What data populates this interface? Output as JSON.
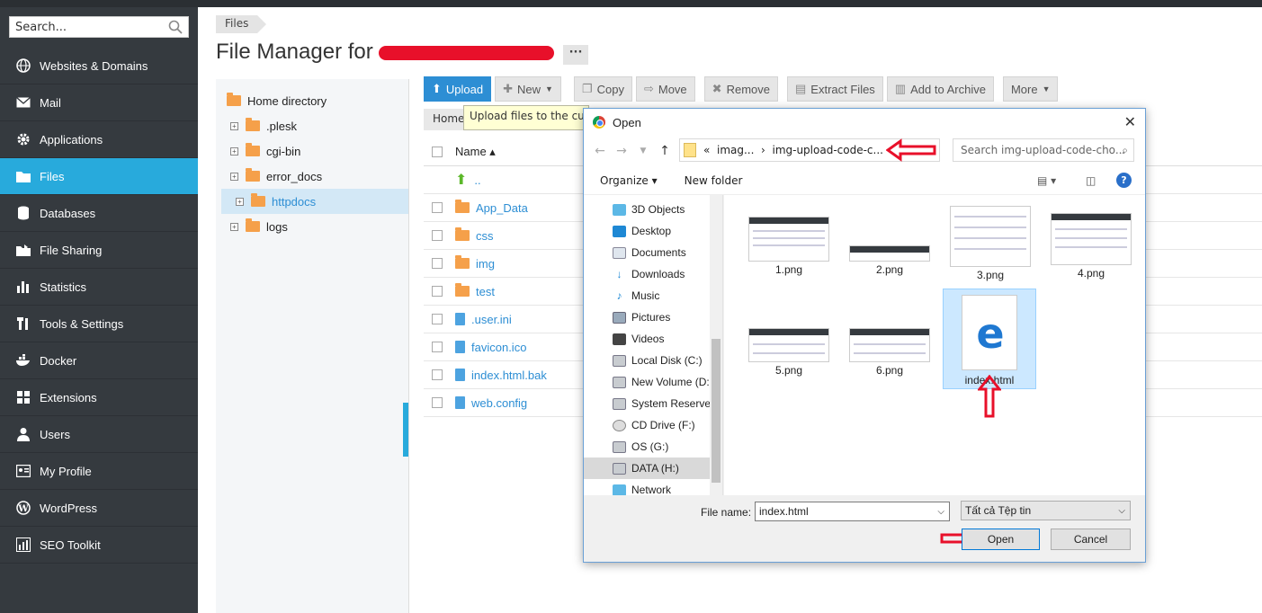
{
  "sidebar": {
    "search_placeholder": "Search...",
    "items": [
      {
        "label": "Websites & Domains",
        "icon": "globe-icon"
      },
      {
        "label": "Mail",
        "icon": "envelope-icon"
      },
      {
        "label": "Applications",
        "icon": "gear-icon"
      },
      {
        "label": "Files",
        "icon": "folder-icon"
      },
      {
        "label": "Databases",
        "icon": "database-icon"
      },
      {
        "label": "File Sharing",
        "icon": "share-icon"
      },
      {
        "label": "Statistics",
        "icon": "bar-chart-icon"
      },
      {
        "label": "Tools & Settings",
        "icon": "tools-icon"
      },
      {
        "label": "Docker",
        "icon": "docker-icon"
      },
      {
        "label": "Extensions",
        "icon": "puzzle-icon"
      },
      {
        "label": "Users",
        "icon": "user-icon"
      },
      {
        "label": "My Profile",
        "icon": "id-card-icon"
      },
      {
        "label": "WordPress",
        "icon": "wordpress-icon"
      },
      {
        "label": "SEO Toolkit",
        "icon": "seo-chart-icon"
      }
    ]
  },
  "header": {
    "breadcrumb": "Files",
    "title": "File Manager for",
    "more": "···"
  },
  "tree": {
    "root": "Home directory",
    "items": [
      ".plesk",
      "cgi-bin",
      "error_docs",
      "httpdocs",
      "logs"
    ]
  },
  "toolbar": {
    "upload": "Upload",
    "new": "New",
    "copy": "Copy",
    "move": "Move",
    "remove": "Remove",
    "extract": "Extract Files",
    "archive": "Add to Archive",
    "more": "More"
  },
  "path": {
    "home": "Home"
  },
  "tooltip": "Upload files to the curr",
  "filelist": {
    "name_header": "Name ▴",
    "up": "..",
    "rows": [
      "App_Data",
      "css",
      "img",
      "test",
      ".user.ini",
      "favicon.ico",
      "index.html.bak",
      "web.config"
    ]
  },
  "dialog": {
    "title": "Open",
    "path_prefix": "«",
    "path_seg1": "imag...",
    "path_seg2": "img-upload-code-c...",
    "search_placeholder": "Search img-upload-code-cho...",
    "organize": "Organize ▾",
    "new_folder": "New folder",
    "nav": [
      "3D Objects",
      "Desktop",
      "Documents",
      "Downloads",
      "Music",
      "Pictures",
      "Videos",
      "Local Disk (C:)",
      "New Volume (D:)",
      "System Reserved",
      "CD Drive (F:)",
      "OS (G:)",
      "DATA (H:)",
      "Network"
    ],
    "files": [
      "1.png",
      "2.png",
      "3.png",
      "4.png",
      "5.png",
      "6.png",
      "index.html"
    ],
    "filename_label": "File name:",
    "filename_value": "index.html",
    "filetype": "Tất cả Tệp tin",
    "open": "Open",
    "cancel": "Cancel"
  },
  "colors": {
    "accent": "#28aadc",
    "sidebar": "#353a3f",
    "link": "#2d8ed4",
    "annotation": "#e8102a"
  }
}
